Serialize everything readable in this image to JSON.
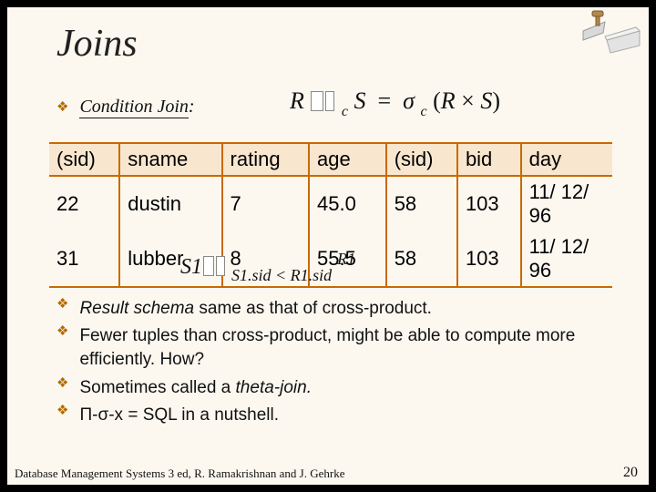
{
  "title": "Joins",
  "condition_label": "Condition Join",
  "formula1": {
    "lhs_R": "R",
    "lhs_S": "S",
    "sub_c1": "c",
    "eq": "=",
    "sigma": "σ",
    "sub_c2": "c",
    "paren_open": "(",
    "R2": "R",
    "cross": "×",
    "S2": "S",
    "paren_close": ")"
  },
  "table": {
    "headers": [
      "(sid)",
      "sname",
      "rating",
      "age",
      "(sid)",
      "bid",
      "day"
    ],
    "rows": [
      [
        "22",
        "dustin",
        "7",
        "45.0",
        "58",
        "103",
        "11/ 12/ 96"
      ],
      [
        "31",
        "lubber",
        "8",
        "55.5",
        "58",
        "103",
        "11/ 12/ 96"
      ]
    ]
  },
  "formula2": {
    "S1": "S1",
    "sub": "S1.sid < R1.sid",
    "R1": "R1"
  },
  "bullets": [
    {
      "text_html": "<i>Result schema</i> same as that of cross-product."
    },
    {
      "text_html": "Fewer tuples than cross-product, might be able to compute more efficiently. How?"
    },
    {
      "text_html": "Sometimes called a <i>theta-join.</i>"
    },
    {
      "text_html": "Π-σ-x = SQL in a nutshell."
    }
  ],
  "footer": "Database Management Systems 3 ed,  R. Ramakrishnan and J. Gehrke",
  "page": "20"
}
